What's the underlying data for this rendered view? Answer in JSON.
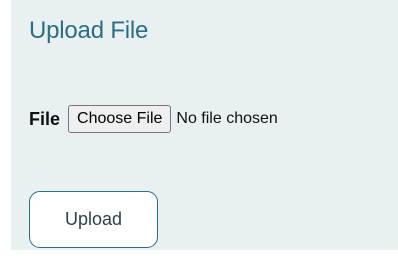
{
  "form": {
    "title": "Upload File",
    "file_label": "File",
    "choose_button_label": "Choose File",
    "file_status": "No file chosen",
    "upload_button_label": "Upload"
  },
  "colors": {
    "panel_background": "#e8f0f1",
    "accent": "#2e6e84"
  }
}
